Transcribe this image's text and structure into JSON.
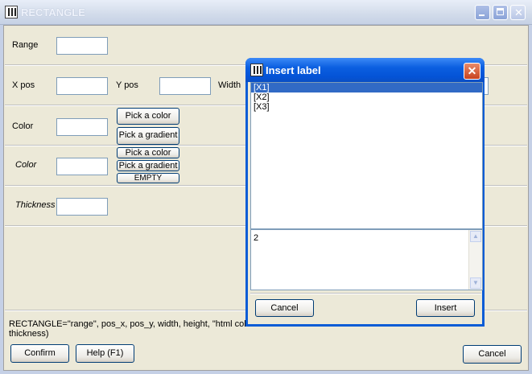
{
  "window": {
    "title": "RECTANGLE"
  },
  "form": {
    "range_label": "Range",
    "xpos_label": "X pos",
    "ypos_label": "Y pos",
    "width_label": "Width",
    "color_label": "Color",
    "pick_color_label": "Pick a color",
    "pick_gradient_label": "Pick a gradient",
    "color2_label": "Color",
    "pick_color2_label": "Pick a color",
    "pick_gradient2_label": "Pick a gradient",
    "empty_label": "EMPTY",
    "thickness_label": "Thickness"
  },
  "footer": {
    "formula_line1": "RECTANGLE=\"range\", pos_x, pos_y, width, height, \"html colo",
    "formula_line2": "thickness)",
    "confirm_label": "Confirm",
    "help_label": "Help (F1)",
    "cancel_label": "Cancel"
  },
  "dialog": {
    "title": "Insert label",
    "close_glyph": "✕",
    "items": [
      "[X1]",
      "[X2]",
      "[X3]"
    ],
    "selected_index": 0,
    "text_value": "2",
    "cancel_label": "Cancel",
    "insert_label": "Insert"
  },
  "colors": {
    "selection": "#316ac5",
    "dialog_title": "#0453d6",
    "close_button": "#c8431f"
  }
}
